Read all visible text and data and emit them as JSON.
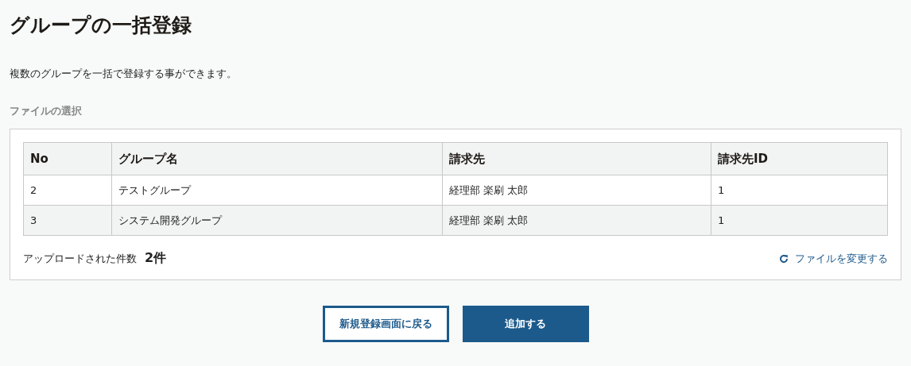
{
  "title": "グループの一括登録",
  "description": "複数のグループを一括で登録する事ができます。",
  "section_label": "ファイルの選択",
  "table": {
    "columns": [
      "No",
      "グループ名",
      "請求先",
      "請求先ID"
    ],
    "rows": [
      [
        "2",
        "テストグループ",
        "経理部 楽刷 太郎",
        "1"
      ],
      [
        "3",
        "システム開発グループ",
        "経理部 楽刷 太郎",
        "1"
      ]
    ]
  },
  "upload_count": {
    "label": "アップロードされた件数",
    "value": "2件"
  },
  "change_file_link": "ファイルを変更する",
  "buttons": [
    {
      "label": "新規登録画面に戻る",
      "kind": "secondary"
    },
    {
      "label": "追加する",
      "kind": "primary"
    }
  ]
}
